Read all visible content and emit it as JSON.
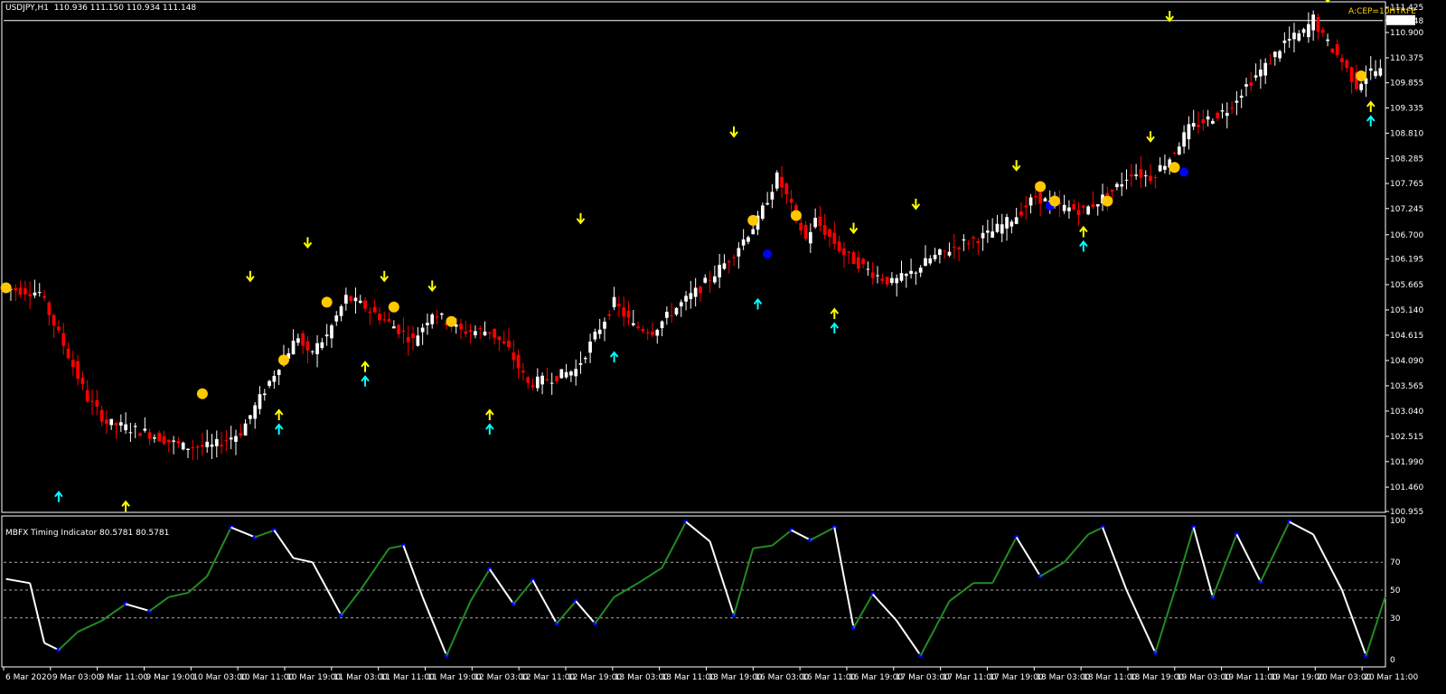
{
  "header": {
    "text": "USDJPY,H1  110.936 111.150 110.934 111.148"
  },
  "signal_note": "A:CEP=10HTRFE",
  "subwindow": {
    "title": "MBFX Timing Indicator 80.5781 80.5781"
  },
  "colors": {
    "background": "#000000",
    "bull_candle": "#ffffff",
    "bear_candle": "#ff0000",
    "arrow_down": "#ffff00",
    "arrow_up_cyan": "#00ffff",
    "dot_yellow": "#ffc800",
    "dot_blue": "#0000ff",
    "osc_up": "#228b22",
    "osc_down": "#ffffff",
    "osc_turn": "#0000ff",
    "level_line": "#aaaaaa"
  },
  "chart_data": [
    {
      "type": "candlestick",
      "symbol": "USDJPY",
      "timeframe": "H1",
      "ohlc_header": {
        "open": 110.936,
        "high": 111.15,
        "low": 110.934,
        "close": 111.148
      },
      "current_price": 111.148,
      "ylim": [
        100.955,
        111.425
      ],
      "y_ticks": [
        "111.425",
        "111.148",
        "110.900",
        "110.375",
        "109.855",
        "109.335",
        "108.810",
        "108.285",
        "107.765",
        "107.245",
        "106.700",
        "106.195",
        "105.665",
        "105.140",
        "104.615",
        "104.090",
        "103.565",
        "103.040",
        "102.515",
        "101.990",
        "101.460",
        "100.955"
      ],
      "x_ticks": [
        "6 Mar 2020",
        "9 Mar 03:00",
        "9 Mar 11:00",
        "9 Mar 19:00",
        "10 Mar 03:00",
        "10 Mar 11:00",
        "10 Mar 19:00",
        "11 Mar 03:00",
        "11 Mar 11:00",
        "11 Mar 19:00",
        "12 Mar 03:00",
        "12 Mar 11:00",
        "12 Mar 19:00",
        "13 Mar 03:00",
        "13 Mar 11:00",
        "13 Mar 19:00",
        "16 Mar 03:00",
        "16 Mar 11:00",
        "16 Mar 19:00",
        "17 Mar 03:00",
        "17 Mar 11:00",
        "17 Mar 19:00",
        "18 Mar 03:00",
        "18 Mar 11:00",
        "18 Mar 19:00",
        "19 Mar 03:00",
        "19 Mar 11:00",
        "19 Mar 19:00",
        "20 Mar 03:00",
        "20 Mar 11:00"
      ],
      "price_path": [
        [
          0,
          105.6
        ],
        [
          8,
          105.5
        ],
        [
          14,
          104.2
        ],
        [
          18,
          103.3
        ],
        [
          22,
          102.8
        ],
        [
          30,
          102.6
        ],
        [
          38,
          102.3
        ],
        [
          44,
          102.3
        ],
        [
          50,
          102.6
        ],
        [
          54,
          103.3
        ],
        [
          58,
          104.0
        ],
        [
          62,
          104.6
        ],
        [
          64,
          104.2
        ],
        [
          68,
          104.6
        ],
        [
          72,
          105.4
        ],
        [
          76,
          105.2
        ],
        [
          82,
          104.8
        ],
        [
          86,
          104.5
        ],
        [
          90,
          105.1
        ],
        [
          96,
          104.7
        ],
        [
          102,
          104.7
        ],
        [
          106,
          104.3
        ],
        [
          110,
          103.6
        ],
        [
          114,
          103.7
        ],
        [
          120,
          103.9
        ],
        [
          124,
          104.6
        ],
        [
          128,
          105.3
        ],
        [
          132,
          104.8
        ],
        [
          136,
          104.7
        ],
        [
          140,
          105.1
        ],
        [
          146,
          105.6
        ],
        [
          152,
          106.2
        ],
        [
          158,
          107.0
        ],
        [
          162,
          107.9
        ],
        [
          164,
          107.5
        ],
        [
          168,
          106.6
        ],
        [
          170,
          107.0
        ],
        [
          176,
          106.3
        ],
        [
          182,
          105.9
        ],
        [
          186,
          105.7
        ],
        [
          190,
          105.9
        ],
        [
          194,
          106.2
        ],
        [
          200,
          106.5
        ],
        [
          206,
          106.7
        ],
        [
          212,
          107.1
        ],
        [
          216,
          107.5
        ],
        [
          220,
          107.3
        ],
        [
          226,
          107.2
        ],
        [
          232,
          107.6
        ],
        [
          236,
          108.0
        ],
        [
          240,
          107.9
        ],
        [
          244,
          108.3
        ],
        [
          248,
          108.9
        ],
        [
          252,
          109.1
        ],
        [
          256,
          109.3
        ],
        [
          260,
          109.8
        ],
        [
          264,
          110.2
        ],
        [
          268,
          110.7
        ],
        [
          272,
          110.9
        ],
        [
          274,
          111.2
        ],
        [
          276,
          110.8
        ],
        [
          280,
          110.3
        ],
        [
          283,
          109.8
        ],
        [
          286,
          110.1
        ]
      ],
      "signals": [
        {
          "kind": "dot_yellow",
          "bar": 0,
          "price": 105.6
        },
        {
          "kind": "arrow_up_cyan",
          "bar": 11,
          "price": 101.3
        },
        {
          "kind": "arrow_up_yellow",
          "bar": 25,
          "price": 101.1
        },
        {
          "kind": "dot_yellow",
          "bar": 41,
          "price": 103.4
        },
        {
          "kind": "arrow_down_yellow",
          "bar": 51,
          "price": 105.8
        },
        {
          "kind": "dot_yellow",
          "bar": 58,
          "price": 104.1
        },
        {
          "kind": "arrow_up_yellow",
          "bar": 57,
          "price": 103.0
        },
        {
          "kind": "arrow_up_cyan",
          "bar": 57,
          "price": 102.7
        },
        {
          "kind": "arrow_down_yellow",
          "bar": 63,
          "price": 106.5
        },
        {
          "kind": "dot_yellow",
          "bar": 67,
          "price": 105.3
        },
        {
          "kind": "arrow_up_yellow",
          "bar": 75,
          "price": 104.0
        },
        {
          "kind": "arrow_up_cyan",
          "bar": 75,
          "price": 103.7
        },
        {
          "kind": "arrow_down_yellow",
          "bar": 79,
          "price": 105.8
        },
        {
          "kind": "dot_yellow",
          "bar": 81,
          "price": 105.2
        },
        {
          "kind": "arrow_down_yellow",
          "bar": 89,
          "price": 105.6
        },
        {
          "kind": "dot_yellow",
          "bar": 93,
          "price": 104.9
        },
        {
          "kind": "arrow_up_yellow",
          "bar": 101,
          "price": 103.0
        },
        {
          "kind": "arrow_up_cyan",
          "bar": 101,
          "price": 102.7
        },
        {
          "kind": "arrow_down_yellow",
          "bar": 120,
          "price": 107.0
        },
        {
          "kind": "arrow_up_cyan",
          "bar": 127,
          "price": 104.2
        },
        {
          "kind": "arrow_down_yellow",
          "bar": 152,
          "price": 108.8
        },
        {
          "kind": "dot_yellow",
          "bar": 156,
          "price": 107.0
        },
        {
          "kind": "dot_blue",
          "bar": 159,
          "price": 106.3
        },
        {
          "kind": "arrow_up_cyan",
          "bar": 157,
          "price": 105.3
        },
        {
          "kind": "dot_yellow",
          "bar": 165,
          "price": 107.1
        },
        {
          "kind": "arrow_down_yellow",
          "bar": 177,
          "price": 106.8
        },
        {
          "kind": "arrow_up_yellow",
          "bar": 173,
          "price": 105.1
        },
        {
          "kind": "arrow_up_cyan",
          "bar": 173,
          "price": 104.8
        },
        {
          "kind": "arrow_down_yellow",
          "bar": 190,
          "price": 107.3
        },
        {
          "kind": "arrow_down_yellow",
          "bar": 211,
          "price": 108.1
        },
        {
          "kind": "dot_yellow",
          "bar": 216,
          "price": 107.7
        },
        {
          "kind": "dot_blue",
          "bar": 218,
          "price": 107.3
        },
        {
          "kind": "dot_yellow",
          "bar": 219,
          "price": 107.4
        },
        {
          "kind": "arrow_up_yellow",
          "bar": 225,
          "price": 106.8
        },
        {
          "kind": "arrow_up_cyan",
          "bar": 225,
          "price": 106.5
        },
        {
          "kind": "dot_yellow",
          "bar": 230,
          "price": 107.4
        },
        {
          "kind": "arrow_down_yellow",
          "bar": 239,
          "price": 108.7
        },
        {
          "kind": "dot_yellow",
          "bar": 244,
          "price": 108.1
        },
        {
          "kind": "dot_blue",
          "bar": 246,
          "price": 108.0
        },
        {
          "kind": "arrow_down_yellow",
          "bar": 243,
          "price": 111.2
        },
        {
          "kind": "arrow_down_yellow",
          "bar": 276,
          "price": 111.6
        },
        {
          "kind": "dot_yellow",
          "bar": 283,
          "price": 110.0
        },
        {
          "kind": "arrow_up_yellow",
          "bar": 285,
          "price": 109.4
        },
        {
          "kind": "arrow_up_cyan",
          "bar": 285,
          "price": 109.1
        }
      ]
    },
    {
      "type": "line",
      "title": "MBFX Timing Indicator 80.5781 80.5781",
      "ylim": [
        0,
        100
      ],
      "y_ticks": [
        100,
        70,
        50,
        30,
        0
      ],
      "levels": [
        70,
        50,
        30
      ],
      "x": [
        0,
        5,
        8,
        11,
        15,
        20,
        25,
        30,
        34,
        38,
        42,
        47,
        52,
        56,
        60,
        64,
        70,
        74,
        80,
        83,
        87,
        92,
        97,
        101,
        106,
        110,
        115,
        119,
        123,
        127,
        132,
        137,
        142,
        147,
        152,
        156,
        160,
        164,
        168,
        173,
        177,
        181,
        186,
        191,
        197,
        202,
        206,
        211,
        216,
        221,
        226,
        229,
        234,
        240,
        245,
        248,
        252,
        257,
        262,
        268,
        273,
        279,
        284,
        288
      ],
      "values": [
        58,
        55,
        12,
        7,
        20,
        28,
        40,
        35,
        45,
        48,
        60,
        95,
        88,
        93,
        73,
        70,
        32,
        50,
        80,
        82,
        45,
        3,
        42,
        65,
        40,
        57,
        26,
        42,
        26,
        45,
        55,
        66,
        99,
        85,
        32,
        80,
        82,
        93,
        86,
        95,
        23,
        47,
        28,
        3,
        42,
        55,
        55,
        88,
        60,
        70,
        90,
        95,
        50,
        5,
        60,
        95,
        45,
        90,
        56,
        99,
        90,
        50,
        3,
        45
      ]
    }
  ]
}
